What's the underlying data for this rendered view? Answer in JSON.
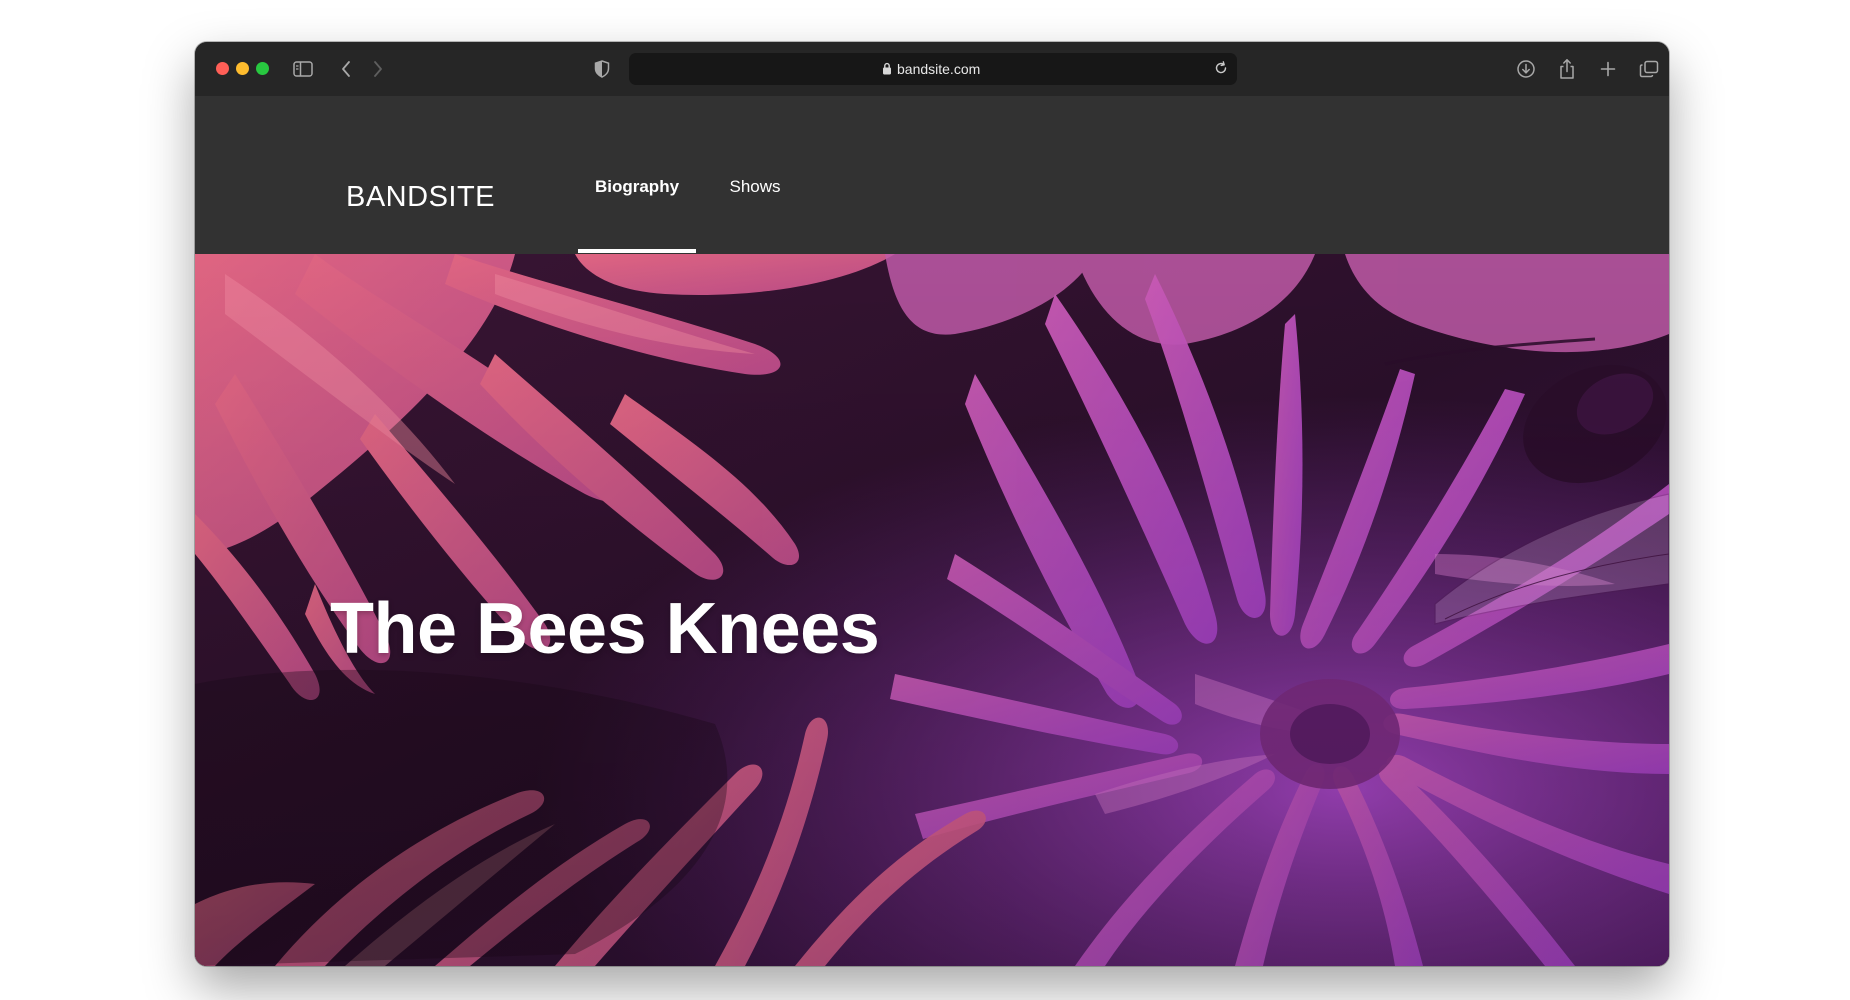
{
  "browser": {
    "url": "bandsite.com",
    "icons": [
      "sidebar-icon",
      "back-icon",
      "forward-icon",
      "shield-icon",
      "lock-icon",
      "reload-icon",
      "download-icon",
      "share-icon",
      "new-tab-icon",
      "tabs-overview-icon"
    ],
    "traffic_colors": {
      "close": "#ff5f57",
      "minimize": "#febc2e",
      "zoom": "#28c840"
    }
  },
  "site": {
    "logo": "BANDSITE",
    "nav": [
      {
        "label": "Biography",
        "active": true
      },
      {
        "label": "Shows",
        "active": false
      }
    ],
    "header_bg": "#323232"
  },
  "hero": {
    "title": "The Bees Knees",
    "overlay_colors": [
      "#d9586a",
      "#b94aa8",
      "#9b3fc4",
      "#2a1126"
    ]
  }
}
